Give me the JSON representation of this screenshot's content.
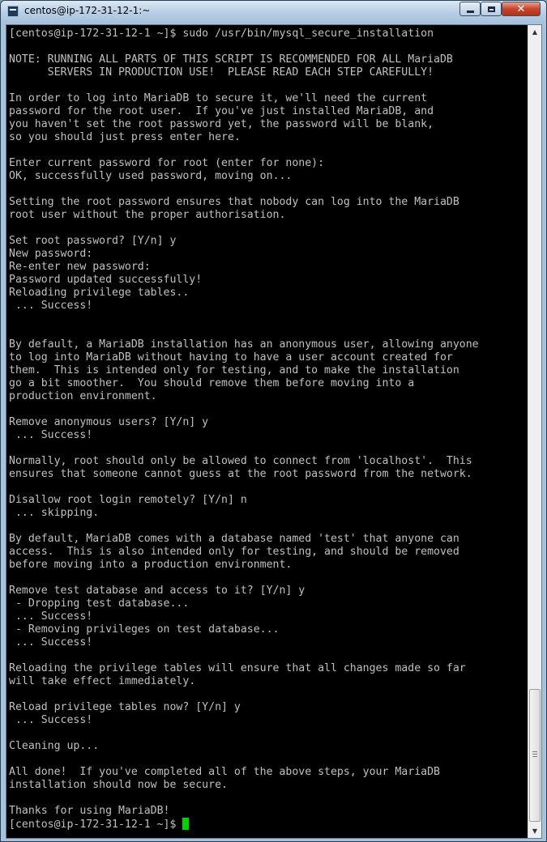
{
  "window": {
    "title": "centos@ip-172-31-12-1:~",
    "icon": "terminal-icon",
    "buttons": {
      "minimize_icon": "minimize-icon",
      "maximize_icon": "maximize-icon",
      "close_label": "✕"
    }
  },
  "terminal": {
    "foreground": "#c0c0c0",
    "background": "#000000",
    "cursor_color": "#00d200",
    "lines": [
      "[centos@ip-172-31-12-1 ~]$ sudo /usr/bin/mysql_secure_installation",
      "",
      "NOTE: RUNNING ALL PARTS OF THIS SCRIPT IS RECOMMENDED FOR ALL MariaDB",
      "      SERVERS IN PRODUCTION USE!  PLEASE READ EACH STEP CAREFULLY!",
      "",
      "In order to log into MariaDB to secure it, we'll need the current",
      "password for the root user.  If you've just installed MariaDB, and",
      "you haven't set the root password yet, the password will be blank,",
      "so you should just press enter here.",
      "",
      "Enter current password for root (enter for none):",
      "OK, successfully used password, moving on...",
      "",
      "Setting the root password ensures that nobody can log into the MariaDB",
      "root user without the proper authorisation.",
      "",
      "Set root password? [Y/n] y",
      "New password:",
      "Re-enter new password:",
      "Password updated successfully!",
      "Reloading privilege tables..",
      " ... Success!",
      "",
      "",
      "By default, a MariaDB installation has an anonymous user, allowing anyone",
      "to log into MariaDB without having to have a user account created for",
      "them.  This is intended only for testing, and to make the installation",
      "go a bit smoother.  You should remove them before moving into a",
      "production environment.",
      "",
      "Remove anonymous users? [Y/n] y",
      " ... Success!",
      "",
      "Normally, root should only be allowed to connect from 'localhost'.  This",
      "ensures that someone cannot guess at the root password from the network.",
      "",
      "Disallow root login remotely? [Y/n] n",
      " ... skipping.",
      "",
      "By default, MariaDB comes with a database named 'test' that anyone can",
      "access.  This is also intended only for testing, and should be removed",
      "before moving into a production environment.",
      "",
      "Remove test database and access to it? [Y/n] y",
      " - Dropping test database...",
      " ... Success!",
      " - Removing privileges on test database...",
      " ... Success!",
      "",
      "Reloading the privilege tables will ensure that all changes made so far",
      "will take effect immediately.",
      "",
      "Reload privilege tables now? [Y/n] y",
      " ... Success!",
      "",
      "Cleaning up...",
      "",
      "All done!  If you've completed all of the above steps, your MariaDB",
      "installation should now be secure.",
      "",
      "Thanks for using MariaDB!"
    ],
    "prompt": "[centos@ip-172-31-12-1 ~]$ "
  },
  "scrollbar": {
    "up_arrow": "▲",
    "down_arrow": "▼"
  }
}
